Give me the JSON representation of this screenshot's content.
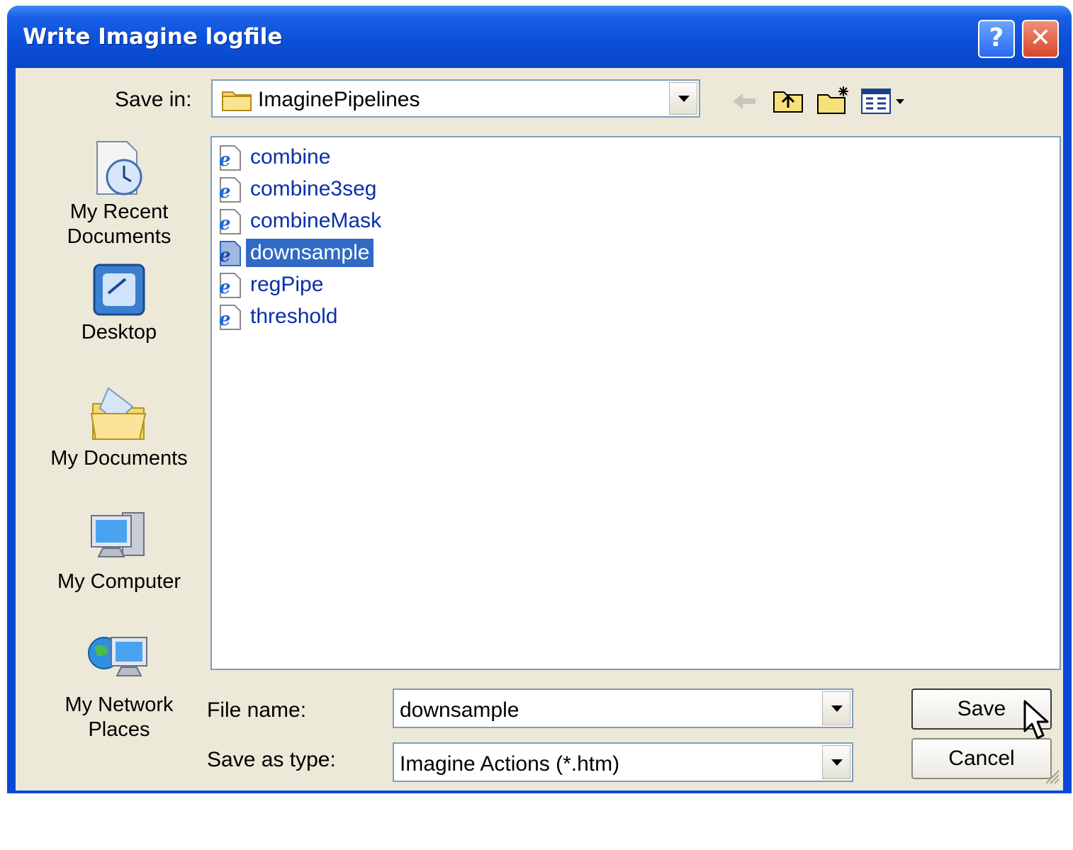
{
  "window": {
    "title": "Write Imagine logfile"
  },
  "titlebar": {
    "help": "?",
    "close": "✕"
  },
  "toolbar": {
    "save_in_label": "Save in:",
    "save_in_value": "ImaginePipelines"
  },
  "places": [
    {
      "label_line1": "My Recent",
      "label_line2": "Documents",
      "icon": "recent-documents-icon"
    },
    {
      "label_line1": "Desktop",
      "label_line2": "",
      "icon": "desktop-icon"
    },
    {
      "label_line1": "My Documents",
      "label_line2": "",
      "icon": "my-documents-icon"
    },
    {
      "label_line1": "My Computer",
      "label_line2": "",
      "icon": "my-computer-icon"
    },
    {
      "label_line1": "My Network",
      "label_line2": "Places",
      "icon": "network-places-icon"
    }
  ],
  "files": [
    {
      "name": "combine",
      "selected": false
    },
    {
      "name": "combine3seg",
      "selected": false
    },
    {
      "name": "combineMask",
      "selected": false
    },
    {
      "name": "downsample",
      "selected": true
    },
    {
      "name": "regPipe",
      "selected": false
    },
    {
      "name": "threshold",
      "selected": false
    }
  ],
  "form": {
    "file_name_label": "File name:",
    "file_name_value": "downsample",
    "save_type_label": "Save as type:",
    "save_type_value": "Imagine Actions (*.htm)"
  },
  "buttons": {
    "save": "Save",
    "cancel": "Cancel"
  },
  "colors": {
    "titlebar": "#0a49d6",
    "selection": "#316ac5",
    "dialog_bg": "#ece9d8",
    "file_text": "#0a2fa8"
  }
}
